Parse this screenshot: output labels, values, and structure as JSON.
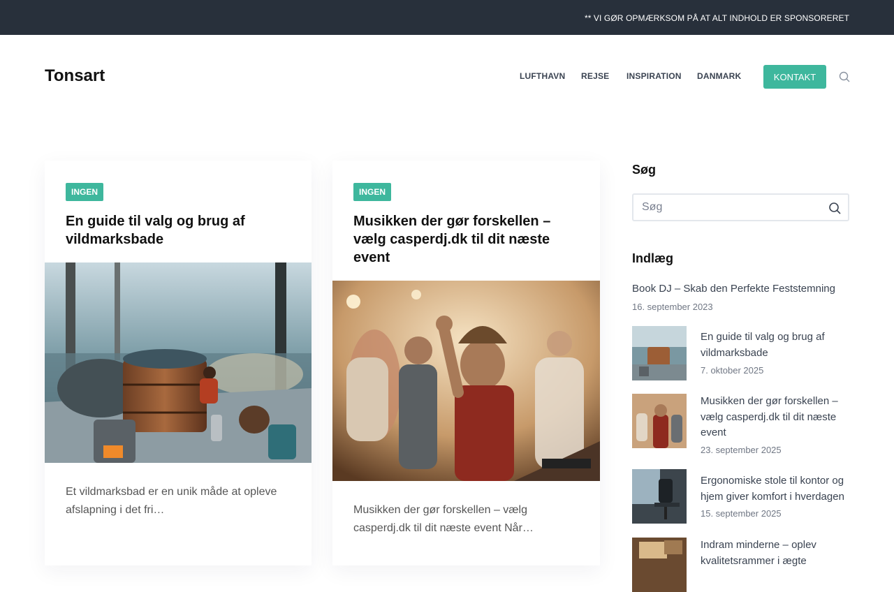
{
  "notice": "** VI GØR OPMÆRKSOM PÅ AT ALT INDHOLD ER SPONSORERET",
  "site_title": "Tonsart",
  "nav": {
    "items": [
      "LUFTHAVN",
      "REJSE",
      "INSPIRATION",
      "DANMARK"
    ],
    "contact": "KONTAKT"
  },
  "posts": [
    {
      "category": "INGEN",
      "title": "En guide til valg og brug af vildmarksbade",
      "excerpt": "Et vildmarksbad er en unik måde at opleve afslapning i det fri…"
    },
    {
      "category": "INGEN",
      "title": "Musikken der gør forskellen – vælg casperdj.dk til dit næste event",
      "excerpt": "Musikken der gør forskellen – vælg casperdj.dk til dit næste event Når…"
    }
  ],
  "sidebar": {
    "search_heading": "Søg",
    "search_placeholder": "Søg",
    "posts_heading": "Indlæg",
    "featured": {
      "title": "Book DJ – Skab den Perfekte Feststemning",
      "date": "16. september 2023"
    },
    "recent": [
      {
        "title": "En guide til valg og brug af vildmarksbade",
        "date": "7. oktober 2025"
      },
      {
        "title": "Musikken der gør forskellen – vælg casperdj.dk til dit næste event",
        "date": "23. september 2025"
      },
      {
        "title": "Ergonomiske stole til kontor og hjem giver komfort i hverdagen",
        "date": "15. september 2025"
      },
      {
        "title": "Indram minderne – oplev kvalitetsrammer i ægte",
        "date": ""
      }
    ]
  },
  "colors": {
    "accent": "#3eb79d",
    "topbar": "#28303b"
  },
  "icons": {
    "search": "search-icon"
  }
}
